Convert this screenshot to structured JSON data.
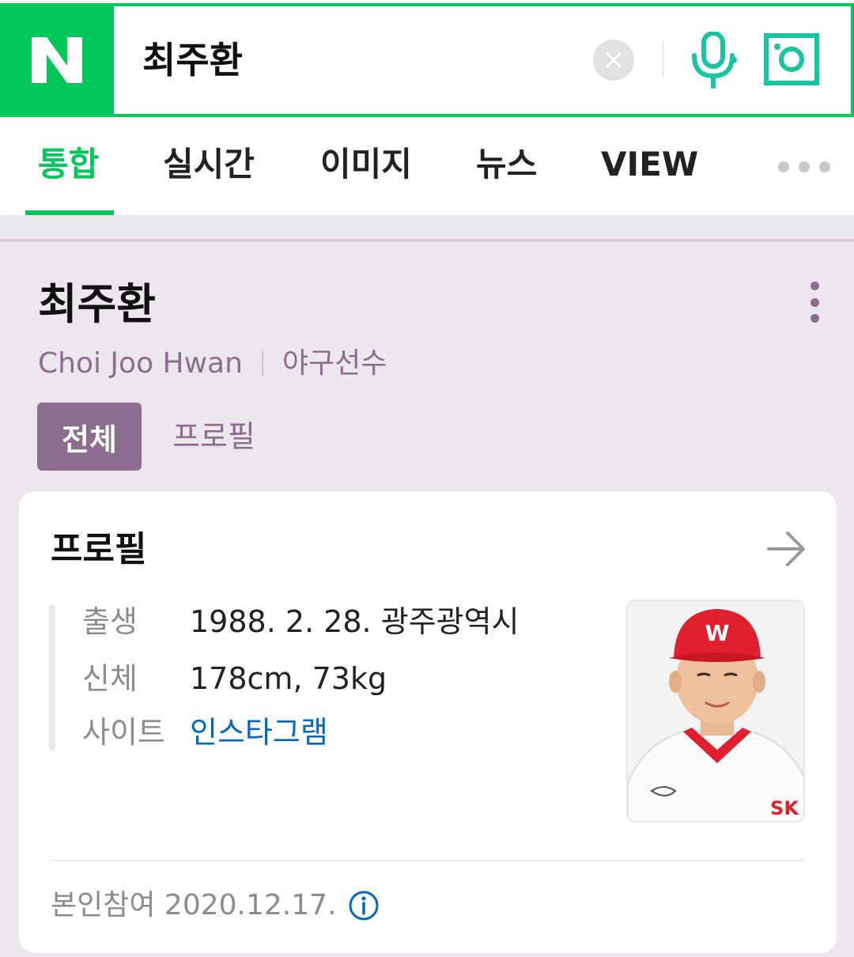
{
  "search": {
    "logo": "N",
    "query": "최주환",
    "icons": {
      "clear": "close-icon",
      "voice": "mic-icon",
      "lens": "camera-lens-icon"
    },
    "brand_color": "#03c75a"
  },
  "tabs": [
    {
      "label": "통합",
      "active": true
    },
    {
      "label": "실시간"
    },
    {
      "label": "이미지"
    },
    {
      "label": "뉴스"
    },
    {
      "label": "VIEW"
    }
  ],
  "person": {
    "name": "최주환",
    "english_name": "Choi Joo Hwan",
    "occupation": "야구선수",
    "accent_color": "#8d6d8f"
  },
  "filter_chips": [
    {
      "label": "전체",
      "active": true
    },
    {
      "label": "프로필"
    }
  ],
  "profile_card": {
    "title": "프로필",
    "rows": [
      {
        "key": "출생",
        "value": "1988. 2. 28. 광주광역시"
      },
      {
        "key": "신체",
        "value": "178cm, 73kg"
      },
      {
        "key": "사이트",
        "value": "인스타그램",
        "is_link": true
      }
    ],
    "footer": "본인참여 2020.12.17.",
    "cap_letter": "W",
    "jersey_mark": "SK"
  }
}
